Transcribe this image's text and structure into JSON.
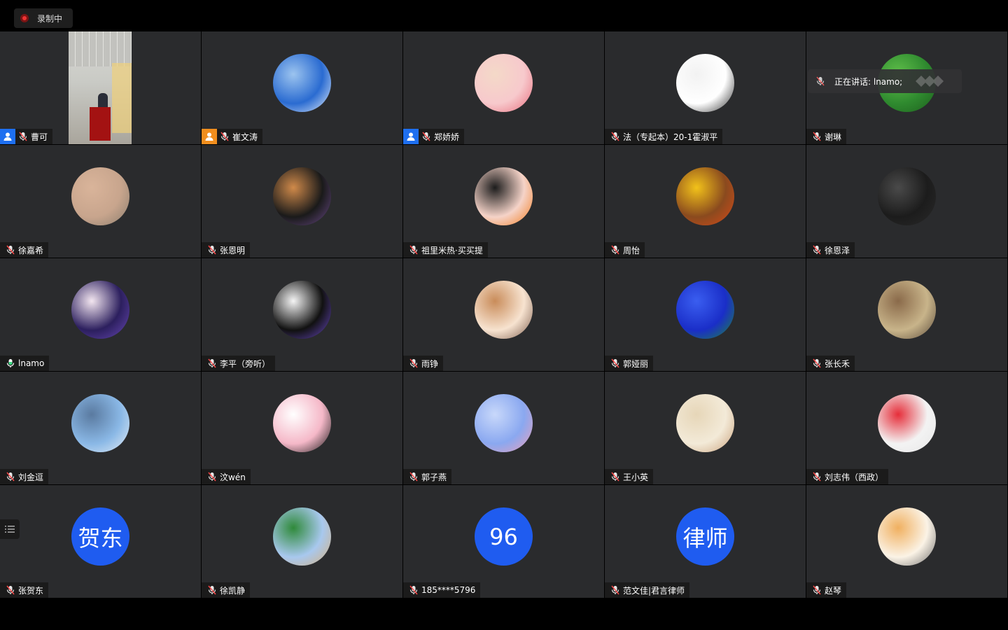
{
  "recording": {
    "label": "录制中"
  },
  "speaking": {
    "text": "正在讲话: lnamo;"
  },
  "participants": [
    {
      "name": "曹可",
      "badge": "blue",
      "mic": "muted",
      "avatar": {
        "kind": "video"
      }
    },
    {
      "name": "崔文涛",
      "badge": "orange",
      "mic": "muted",
      "avatar": {
        "kind": "image",
        "colors": [
          "#2a6bd1",
          "#9cc4ef",
          "#e8f1fb"
        ]
      }
    },
    {
      "name": "郑娇娇",
      "badge": "blue",
      "mic": "muted",
      "avatar": {
        "kind": "image",
        "colors": [
          "#f7c9cc",
          "#f4d9c8",
          "#e76a7a"
        ]
      }
    },
    {
      "name": "法（专起本）20-1霍淑平",
      "mic": "muted",
      "avatar": {
        "kind": "image",
        "colors": [
          "#ffffff",
          "#f2f2f2",
          "#2b2b2b"
        ]
      }
    },
    {
      "name": "谢琳",
      "mic": "muted",
      "avatar": {
        "kind": "image",
        "colors": [
          "#2f8a2f",
          "#5fbf4a",
          "#1d5e1d"
        ]
      }
    },
    {
      "name": "徐嘉希",
      "mic": "muted",
      "avatar": {
        "kind": "image",
        "colors": [
          "#c8a58d",
          "#d9b49a",
          "#8a7d6e"
        ]
      }
    },
    {
      "name": "张恩明",
      "mic": "muted",
      "avatar": {
        "kind": "image",
        "colors": [
          "#1a1a1a",
          "#d08a4a",
          "#6b4a8a"
        ]
      }
    },
    {
      "name": "祖里米热·买买提",
      "mic": "muted",
      "avatar": {
        "kind": "image",
        "colors": [
          "#f5d3c8",
          "#1c1c1c",
          "#f27a1a"
        ]
      }
    },
    {
      "name": "周怡",
      "mic": "muted",
      "avatar": {
        "kind": "image",
        "colors": [
          "#8a4a1e",
          "#f2c21a",
          "#d94a1a"
        ]
      }
    },
    {
      "name": "徐恩泽",
      "mic": "muted",
      "avatar": {
        "kind": "image",
        "colors": [
          "#1c1c1c",
          "#4a4a4a",
          "#2a2a2a"
        ]
      }
    },
    {
      "name": "lnamo",
      "mic": "active",
      "avatar": {
        "kind": "image",
        "colors": [
          "#2c1f5e",
          "#f3e6f0",
          "#6a4ab8"
        ]
      }
    },
    {
      "name": "李平（旁听）",
      "mic": "muted",
      "avatar": {
        "kind": "image",
        "colors": [
          "#111111",
          "#f5f5f5",
          "#6b4ac8"
        ]
      }
    },
    {
      "name": "雨铮",
      "mic": "muted",
      "avatar": {
        "kind": "image",
        "colors": [
          "#f7e3d0",
          "#c98c5a",
          "#7a5a4a"
        ]
      }
    },
    {
      "name": "郭娅丽",
      "mic": "muted",
      "avatar": {
        "kind": "image",
        "colors": [
          "#1a2ec8",
          "#3a5ef0",
          "#1f8a3a"
        ]
      }
    },
    {
      "name": "张长禾",
      "mic": "muted",
      "avatar": {
        "kind": "image",
        "colors": [
          "#c8b48a",
          "#8a6a4a",
          "#5a4a3a"
        ]
      }
    },
    {
      "name": "刘金逗",
      "mic": "muted",
      "avatar": {
        "kind": "image",
        "colors": [
          "#8ab8e6",
          "#5a7aa0",
          "#e6eef6"
        ]
      }
    },
    {
      "name": "汶wén",
      "mic": "muted",
      "avatar": {
        "kind": "image",
        "colors": [
          "#f5b8c8",
          "#ffffff",
          "#111111"
        ]
      }
    },
    {
      "name": "郭子燕",
      "mic": "muted",
      "avatar": {
        "kind": "image",
        "colors": [
          "#8aa8f0",
          "#c8d8fa",
          "#f0a0b8"
        ]
      }
    },
    {
      "name": "王小英",
      "mic": "muted",
      "avatar": {
        "kind": "image",
        "colors": [
          "#f3ead8",
          "#e6d6b8",
          "#c8a07a"
        ]
      }
    },
    {
      "name": "刘志伟（西政）",
      "mic": "muted",
      "avatar": {
        "kind": "image",
        "colors": [
          "#f3f3f3",
          "#e62e3a",
          "#e6e6e6"
        ]
      }
    },
    {
      "name": "张贺东",
      "mic": "muted",
      "avatar": {
        "kind": "text",
        "text": "贺东"
      }
    },
    {
      "name": "徐凯静",
      "mic": "muted",
      "avatar": {
        "kind": "image",
        "colors": [
          "#a8c8ee",
          "#2f8a3a",
          "#d8b07a"
        ]
      }
    },
    {
      "name": "185****5796",
      "mic": "muted",
      "avatar": {
        "kind": "text",
        "text": "96"
      }
    },
    {
      "name": "范文佳|君言律师",
      "mic": "muted",
      "avatar": {
        "kind": "text",
        "text": "律师"
      }
    },
    {
      "name": "赵琴",
      "mic": "muted",
      "avatar": {
        "kind": "image",
        "colors": [
          "#fbf3e6",
          "#f0b060",
          "#6a6a6a"
        ]
      }
    }
  ]
}
